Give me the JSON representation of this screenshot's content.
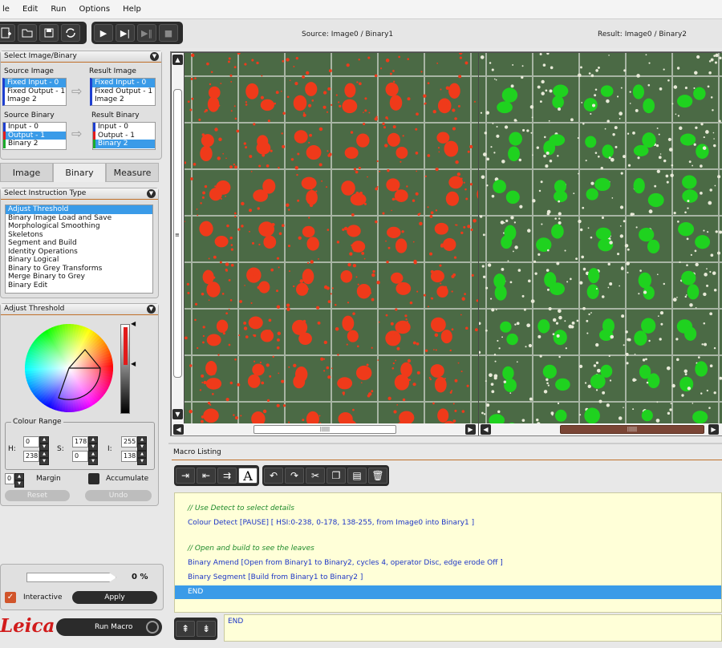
{
  "menu": [
    "le",
    "Edit",
    "Run",
    "Options",
    "Help"
  ],
  "viewer": {
    "source_label": "Source: Image0 / Binary1",
    "result_label": "Result: Image0 / Binary2"
  },
  "select_panel": {
    "title": "Select Image/Binary",
    "source_image": {
      "label": "Source Image",
      "items": [
        "Fixed Input - 0",
        "Fixed Output - 1",
        "Image 2"
      ],
      "selected": 0
    },
    "result_image": {
      "label": "Result Image",
      "items": [
        "Fixed Input - 0",
        "Fixed Output - 1",
        "Image 2"
      ],
      "selected": 0
    },
    "source_binary": {
      "label": "Source Binary",
      "items": [
        "Input - 0",
        "Output - 1",
        "Binary 2"
      ],
      "selected": 1
    },
    "result_binary": {
      "label": "Result Binary",
      "items": [
        "Input - 0",
        "Output - 1",
        "Binary 2"
      ],
      "selected": 2
    }
  },
  "tabs": [
    "Image",
    "Binary",
    "Measure"
  ],
  "active_tab": 1,
  "instruction_panel": {
    "title": "Select Instruction Type",
    "items": [
      "Adjust Threshold",
      "Binary Image Load and Save",
      "Morphological Smoothing",
      "Skeletons",
      "Segment and Build",
      "Identity Operations",
      "Binary Logical",
      "Binary to Grey Transforms",
      "Merge Binary to Grey",
      "Binary Edit"
    ],
    "selected": 0
  },
  "threshold_panel": {
    "title": "Adjust Threshold",
    "colour_range_label": "Colour Range",
    "h_label": "H:",
    "s_label": "S:",
    "i_label": "I:",
    "h_min": "0",
    "h_max": "238",
    "s_min": "178",
    "s_max": "0",
    "i_min": "255",
    "i_max": "138",
    "margin_value": "0",
    "margin_label": "Margin",
    "accumulate_label": "Accumulate",
    "reset_label": "Reset",
    "undo_label": "Undo"
  },
  "progress": {
    "percent_text": "0 %",
    "value": 0
  },
  "interactive_label": "Interactive",
  "apply_label": "Apply",
  "logo_text": "Leica",
  "run_macro_label": "Run Macro",
  "macro": {
    "title": "Macro Listing",
    "lines": [
      {
        "text": "// Use Detect to select details",
        "type": "comment"
      },
      {
        "text": "Colour Detect [PAUSE] [ HSI:0-238, 0-178, 138-255, from Image0 into Binary1 ]",
        "type": "code"
      },
      {
        "text": "",
        "type": "blank"
      },
      {
        "text": "// Open and build to see the leaves",
        "type": "comment"
      },
      {
        "text": "Binary Amend [Open from Binary1 to Binary2, cycles 4, operator Disc, edge erode Off ]",
        "type": "code"
      },
      {
        "text": "Binary Segment [Build from Binary1 to Binary2 ]",
        "type": "code"
      },
      {
        "text": "END",
        "type": "selected"
      }
    ],
    "edit_line": "END"
  },
  "colors": {
    "accent": "#c0702a",
    "selection": "#3a9be8",
    "detect_red": "#ef3a1a",
    "result_green": "#1fd21f"
  }
}
